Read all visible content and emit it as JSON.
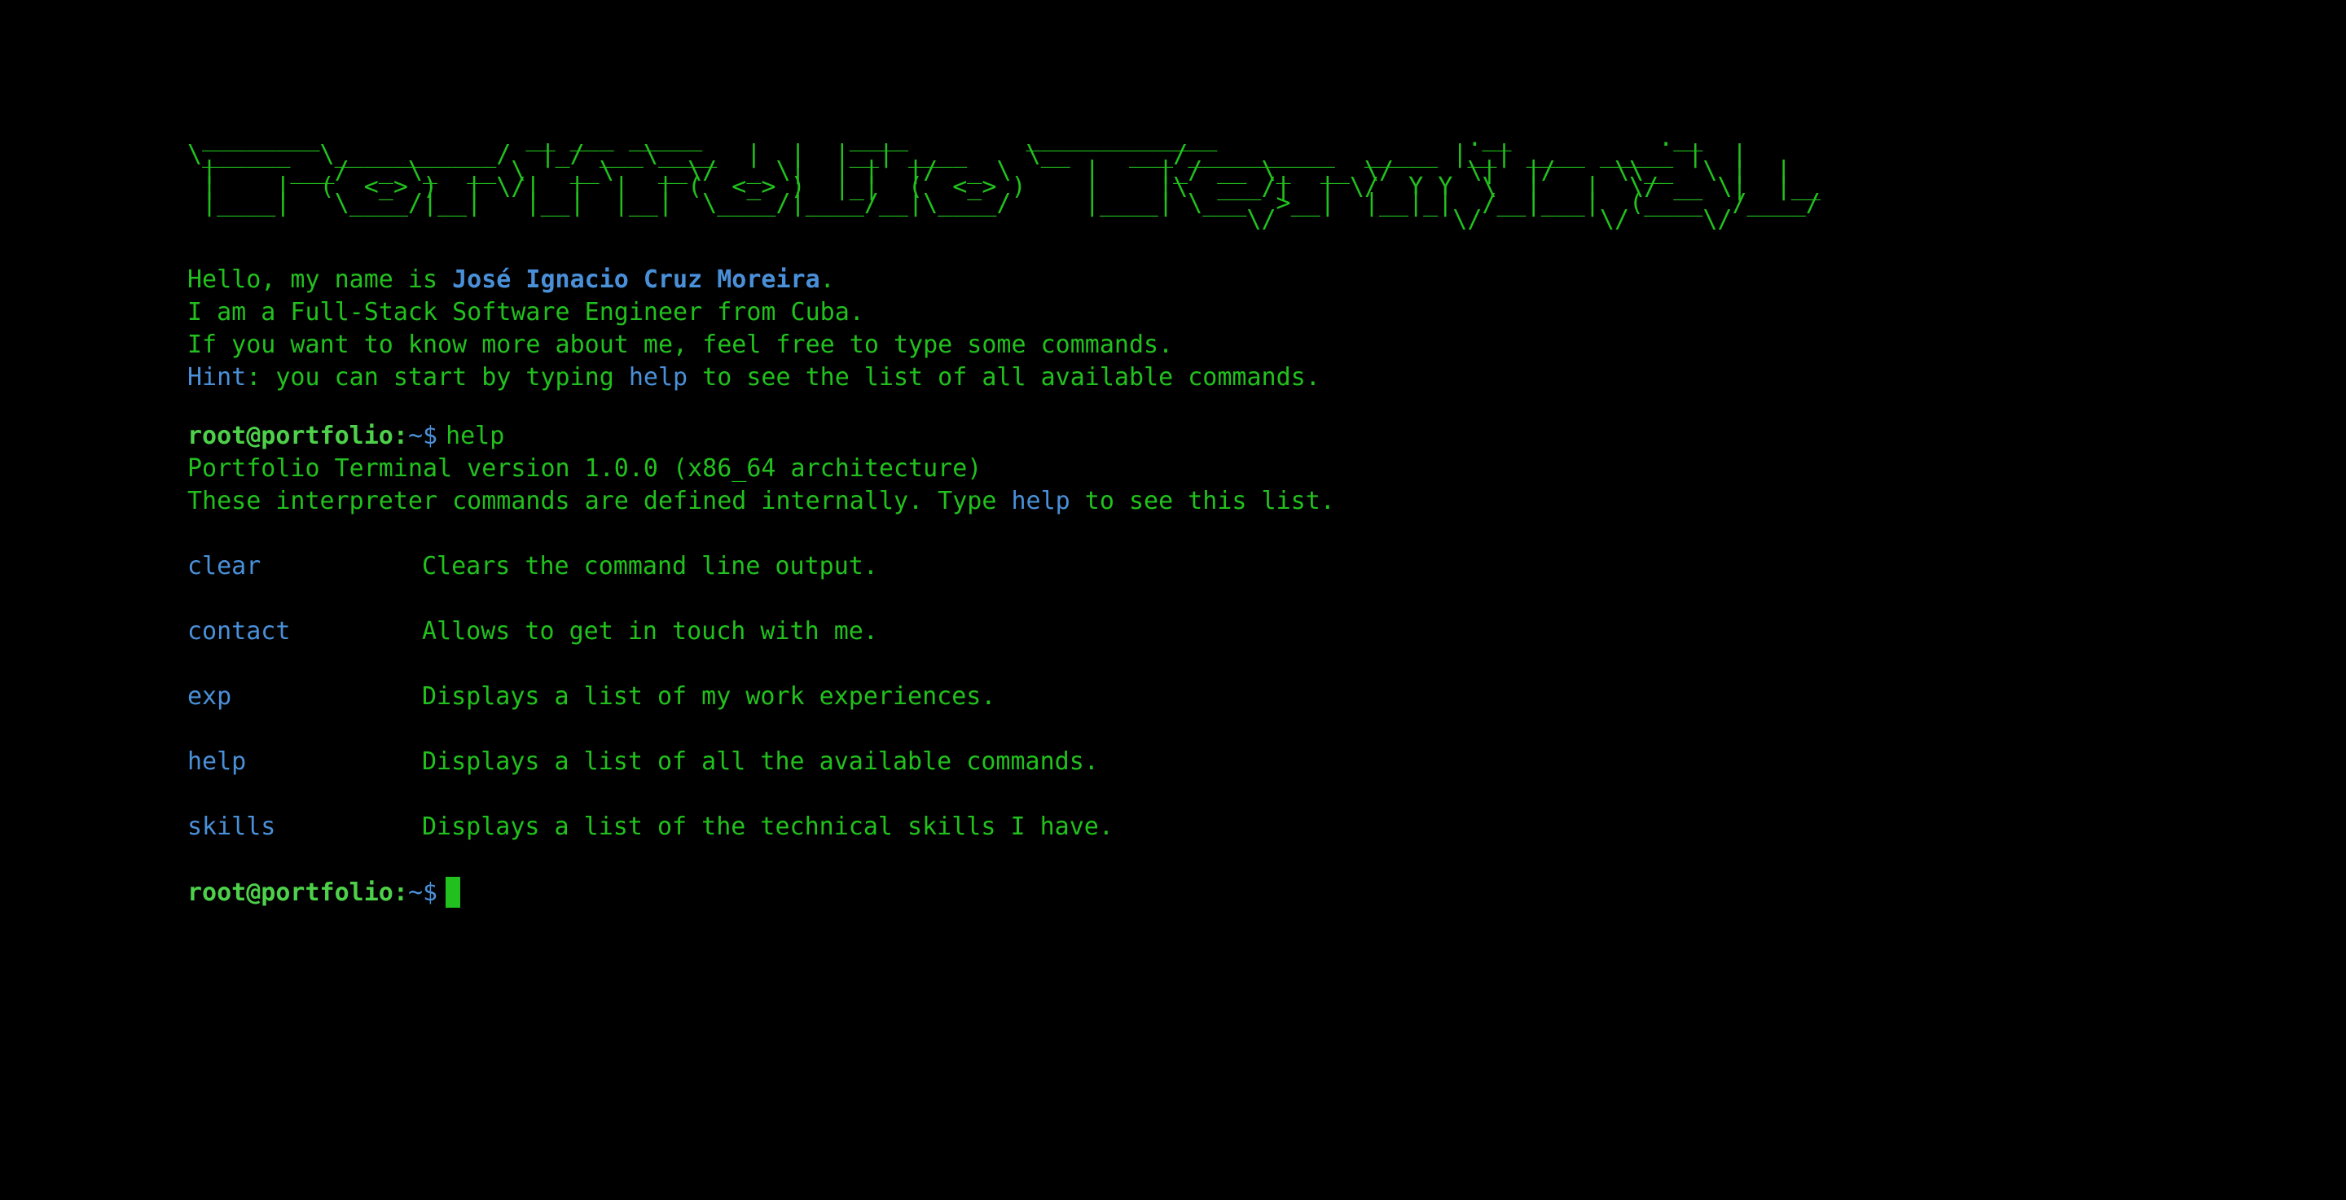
{
  "banner": {
    "ascii_art": " ________              __ ___ _____          ____        _____________                 .__          .__\n\\______  \\___________/  |_/ ___\\____  |  |  |__| ____    \\__    ___/__________  _____ |__| ____ _____ |  |\n |     ___/  _ \\_  __ \\   __\\   __\\/  _ \\|  | |  |/  _ \\     |    |_/ __ \\_  __ \\/     \\|  |/    \\\\__  \\ |  |\n |    |  (  <_> )  | \\/|  |  |  | (  <_> )  |_|  (  <_> )    |    |\\  ___/|  | \\/  Y Y  \\  |   |  \\/ __ \\|  |__\n |____|   \\____/|__|   |__|  |__|  \\____/|____/__|\\____/     |____| \\___  >__|  |__|_|  /__|___|  (____  /____/\n                                                                        \\/            \\/        \\/     \\/"
  },
  "intro": {
    "line1_prefix": "Hello, my name is ",
    "line1_name": "José Ignacio Cruz Moreira",
    "line1_suffix": ".",
    "line2": "I am a Full-Stack Software Engineer from Cuba.",
    "line3": "If you want to know more about me, feel free to type some commands.",
    "hint_label": "Hint",
    "hint_prefix": ": you can start by typing ",
    "hint_cmd": "help",
    "hint_suffix": " to see the list of all available commands."
  },
  "prompt": {
    "user": "root@portfolio:",
    "path": "~",
    "symbol": "$"
  },
  "history": {
    "command": "help",
    "version_line": "Portfolio Terminal version 1.0.0 (x86_64 architecture)",
    "defined_prefix": "These interpreter commands are defined internally. Type ",
    "defined_cmd": "help",
    "defined_suffix": " to see this list."
  },
  "commands": [
    {
      "name": "clear",
      "description": "Clears the command line output."
    },
    {
      "name": "contact",
      "description": "Allows to get in touch with me."
    },
    {
      "name": "exp",
      "description": "Displays a list of my work experiences."
    },
    {
      "name": "help",
      "description": "Displays a list of all the available commands."
    },
    {
      "name": "skills",
      "description": "Displays a list of the technical skills I have."
    }
  ],
  "colors": {
    "background": "#000000",
    "text_green": "#22c01e",
    "prompt_green": "#4ed14a",
    "accent_blue": "#4a90d9"
  }
}
